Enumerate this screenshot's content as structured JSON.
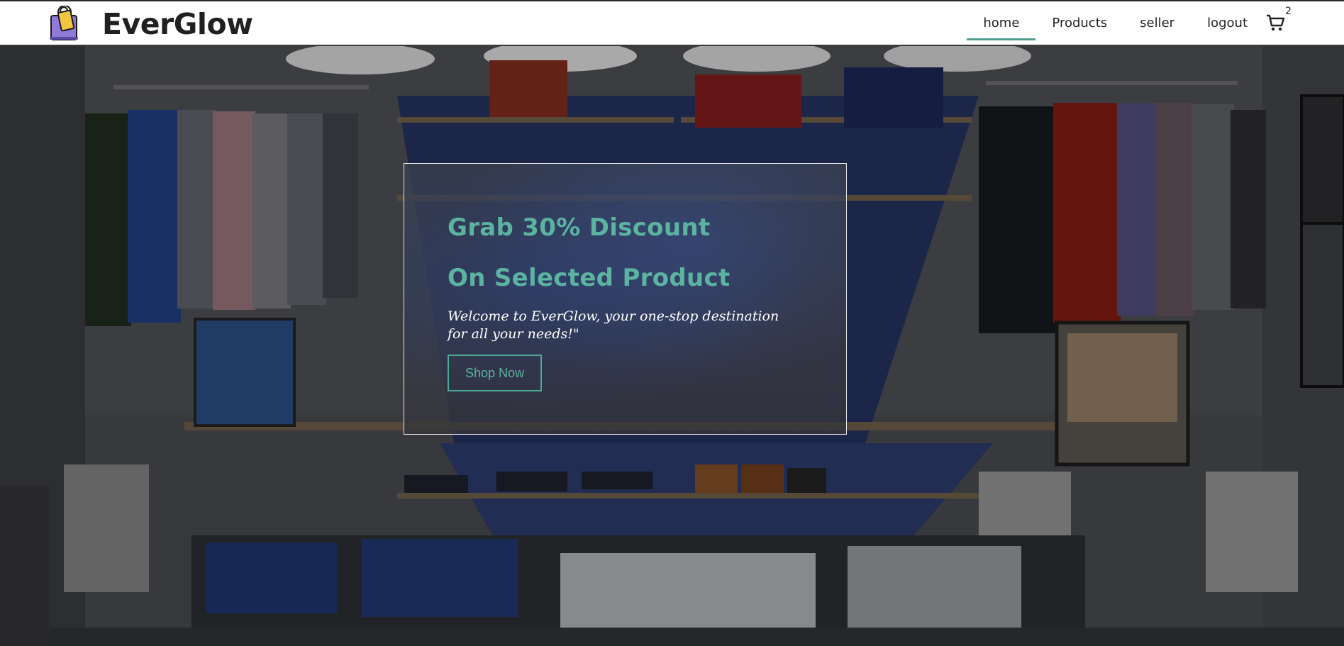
{
  "brand": {
    "name": "EverGlow",
    "logo_icon": "shopping-bags-icon"
  },
  "nav": {
    "links": [
      "home",
      "Products",
      "seller",
      "logout"
    ],
    "active": "home",
    "cart_icon": "cart-icon",
    "cart_count": "2"
  },
  "promo": {
    "title_line1": "Grab 30% Discount",
    "title_line2": "On Selected Product",
    "text": "Welcome to EverGlow, your one-stop destination for all your needs!\"",
    "button_label": "Shop Now"
  },
  "colors": {
    "accent": "#5bb3a0",
    "navbar_bg": "#ffffff",
    "active_underline": "#4f9e8e"
  }
}
